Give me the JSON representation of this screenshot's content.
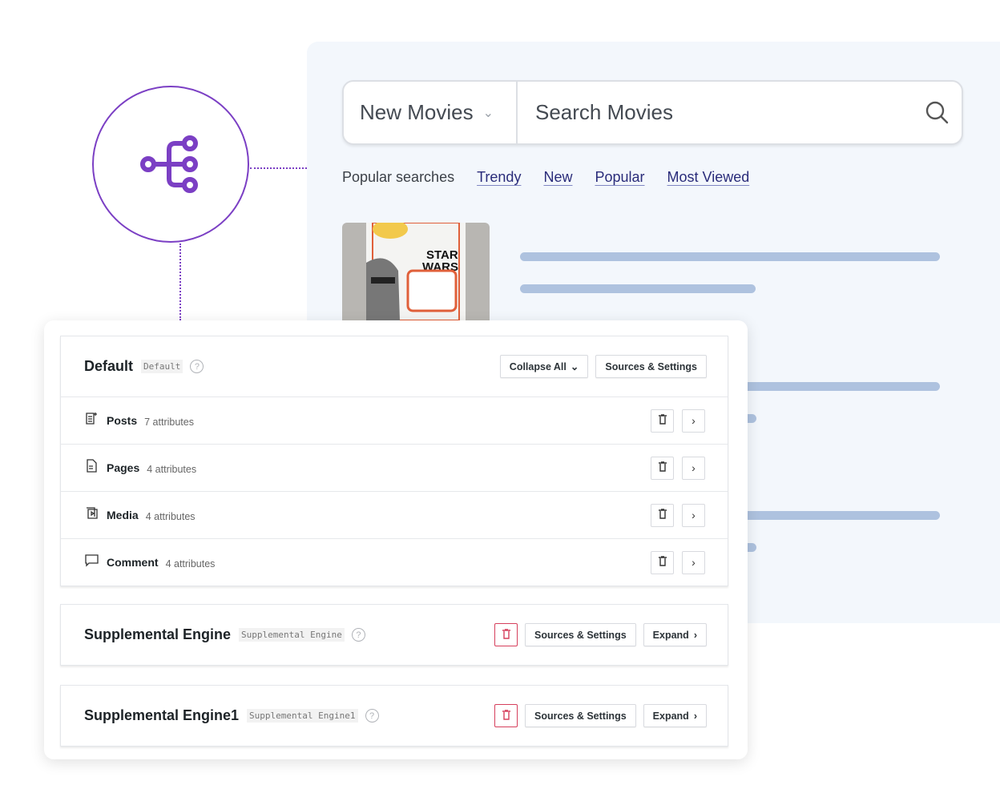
{
  "search": {
    "collection": "New Movies",
    "placeholder": "Search Movies"
  },
  "popular": {
    "label": "Popular searches",
    "links": [
      "Trendy",
      "New",
      "Popular",
      "Most Viewed"
    ]
  },
  "colors": {
    "accent": "#7b3fc4",
    "link": "#2a2c7a",
    "danger": "#d63f5c",
    "skeleton": "#aec2df"
  },
  "default_engine": {
    "title": "Default",
    "slug": "Default",
    "collapse_label": "Collapse All",
    "settings_label": "Sources & Settings",
    "rows": [
      {
        "name": "Posts",
        "attrs": "7 attributes",
        "icon": "post-icon"
      },
      {
        "name": "Pages",
        "attrs": "4 attributes",
        "icon": "page-icon"
      },
      {
        "name": "Media",
        "attrs": "4 attributes",
        "icon": "media-icon"
      },
      {
        "name": "Comment",
        "attrs": "4 attributes",
        "icon": "comment-icon"
      }
    ]
  },
  "engines": [
    {
      "title": "Supplemental Engine",
      "slug": "Supplemental Engine",
      "settings_label": "Sources & Settings",
      "expand_label": "Expand"
    },
    {
      "title": "Supplemental Engine1",
      "slug": "Supplemental Engine1",
      "settings_label": "Sources & Settings",
      "expand_label": "Expand"
    }
  ]
}
